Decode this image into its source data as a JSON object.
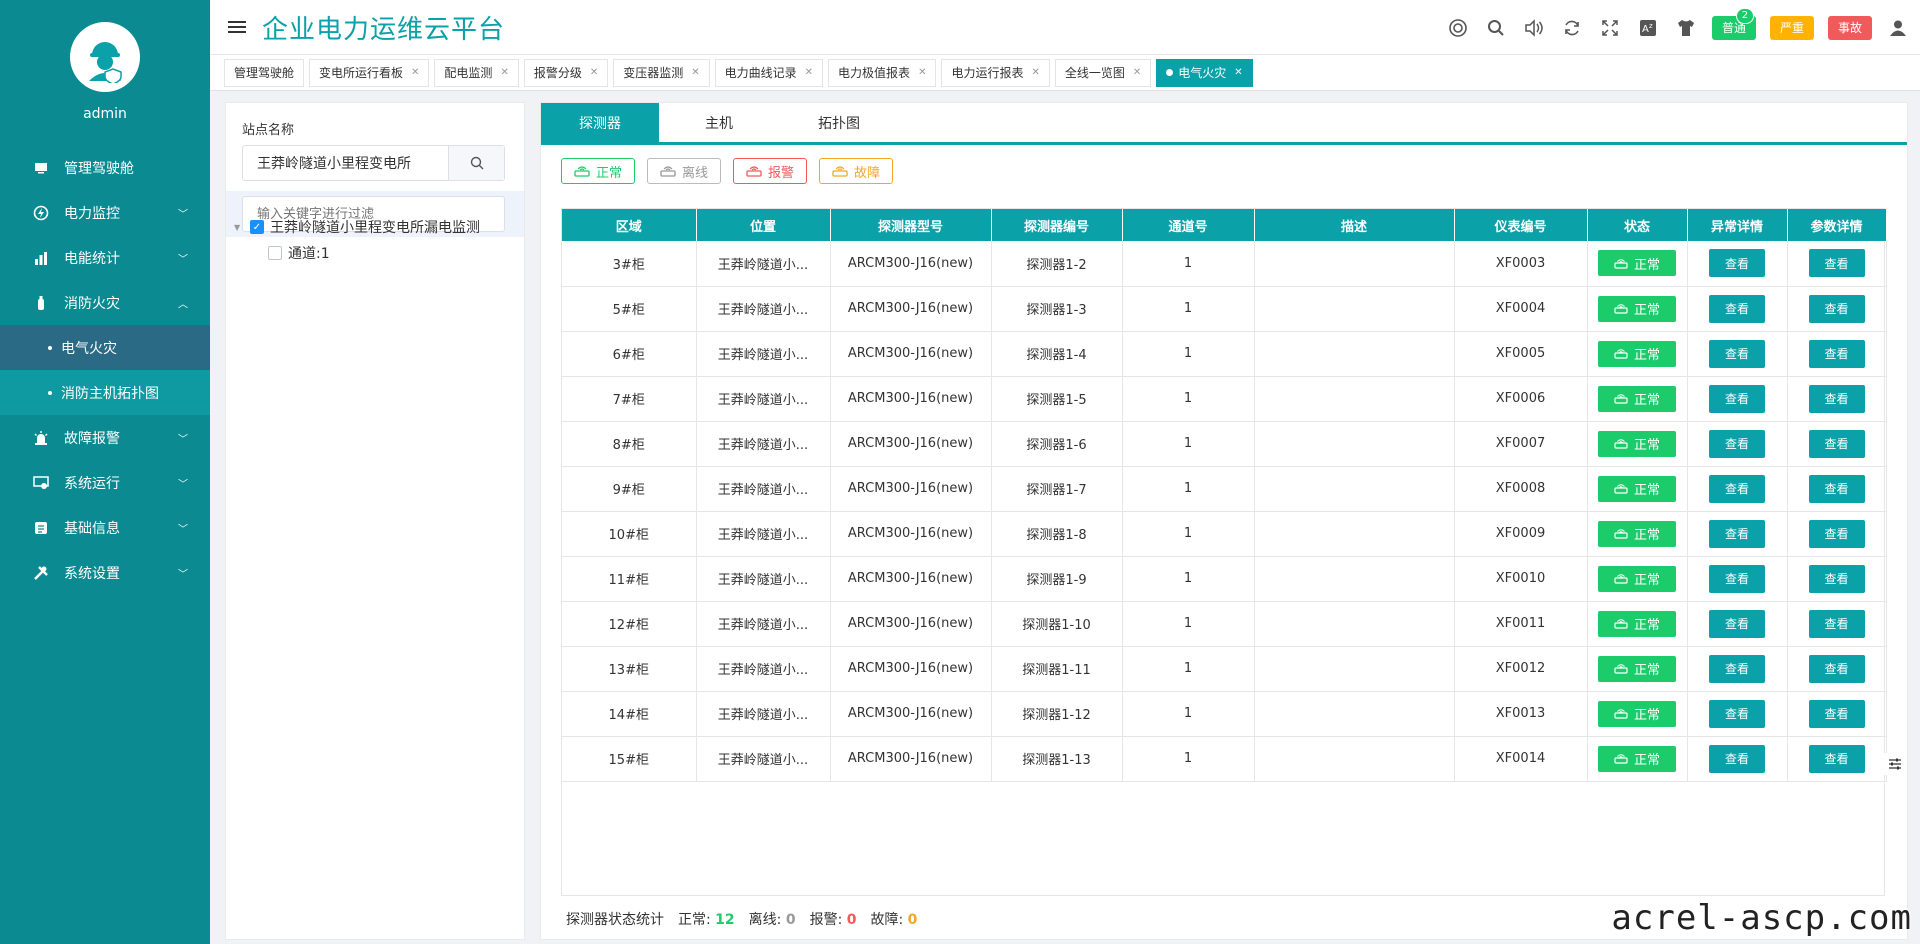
{
  "app": {
    "title": "企业电力运维云平台",
    "username": "admin"
  },
  "sidebar": {
    "items": [
      {
        "label": "管理驾驶舱",
        "icon": "monitor-icon",
        "has_children": false
      },
      {
        "label": "电力监控",
        "icon": "power-icon",
        "has_children": true
      },
      {
        "label": "电能统计",
        "icon": "bar-chart-icon",
        "has_children": true
      },
      {
        "label": "消防火灾",
        "icon": "extinguisher-icon",
        "has_children": true,
        "expanded": true
      },
      {
        "label": "故障报警",
        "icon": "alarm-icon",
        "has_children": true
      },
      {
        "label": "系统运行",
        "icon": "system-icon",
        "has_children": true
      },
      {
        "label": "基础信息",
        "icon": "info-icon",
        "has_children": true
      },
      {
        "label": "系统设置",
        "icon": "tools-icon",
        "has_children": true
      }
    ],
    "subitems": [
      {
        "label": "电气火灾",
        "active": true
      },
      {
        "label": "消防主机拓扑图",
        "active": false
      }
    ]
  },
  "header": {
    "pills": {
      "normal": "普通",
      "normal_count": "2",
      "serious": "严重",
      "accident": "事故"
    }
  },
  "tabs": [
    {
      "label": "管理驾驶舱",
      "closable": false
    },
    {
      "label": "变电所运行看板",
      "closable": true
    },
    {
      "label": "配电监测",
      "closable": true
    },
    {
      "label": "报警分级",
      "closable": true
    },
    {
      "label": "变压器监测",
      "closable": true
    },
    {
      "label": "电力曲线记录",
      "closable": true
    },
    {
      "label": "电力极值报表",
      "closable": true
    },
    {
      "label": "电力运行报表",
      "closable": true
    },
    {
      "label": "全线一览图",
      "closable": true
    },
    {
      "label": "电气火灾",
      "closable": true,
      "active": true
    }
  ],
  "left_panel": {
    "station_label": "站点名称",
    "station_value": "王莽岭隧道小里程变电所",
    "filter_placeholder": "输入关键字进行过滤",
    "tree_root": "王莽岭隧道小里程变电所漏电监测",
    "tree_child": "通道:1"
  },
  "main": {
    "tabs": [
      "探测器",
      "主机",
      "拓扑图"
    ],
    "legend": {
      "normal": "正常",
      "offline": "离线",
      "alarm": "报警",
      "fault": "故障"
    },
    "columns": [
      "区域",
      "位置",
      "探测器型号",
      "探测器编号",
      "通道号",
      "描述",
      "仪表编号",
      "状态",
      "异常详情",
      "参数详情"
    ],
    "rows": [
      {
        "area": "3#柜",
        "location": "王莽岭隧道小...",
        "model": "ARCM300-J16(new)",
        "number": "探测器1-2",
        "channel": "1",
        "desc": "",
        "meter": "XF0003",
        "status": "正常",
        "detail": "查看",
        "param": "查看"
      },
      {
        "area": "5#柜",
        "location": "王莽岭隧道小...",
        "model": "ARCM300-J16(new)",
        "number": "探测器1-3",
        "channel": "1",
        "desc": "",
        "meter": "XF0004",
        "status": "正常",
        "detail": "查看",
        "param": "查看"
      },
      {
        "area": "6#柜",
        "location": "王莽岭隧道小...",
        "model": "ARCM300-J16(new)",
        "number": "探测器1-4",
        "channel": "1",
        "desc": "",
        "meter": "XF0005",
        "status": "正常",
        "detail": "查看",
        "param": "查看"
      },
      {
        "area": "7#柜",
        "location": "王莽岭隧道小...",
        "model": "ARCM300-J16(new)",
        "number": "探测器1-5",
        "channel": "1",
        "desc": "",
        "meter": "XF0006",
        "status": "正常",
        "detail": "查看",
        "param": "查看"
      },
      {
        "area": "8#柜",
        "location": "王莽岭隧道小...",
        "model": "ARCM300-J16(new)",
        "number": "探测器1-6",
        "channel": "1",
        "desc": "",
        "meter": "XF0007",
        "status": "正常",
        "detail": "查看",
        "param": "查看"
      },
      {
        "area": "9#柜",
        "location": "王莽岭隧道小...",
        "model": "ARCM300-J16(new)",
        "number": "探测器1-7",
        "channel": "1",
        "desc": "",
        "meter": "XF0008",
        "status": "正常",
        "detail": "查看",
        "param": "查看"
      },
      {
        "area": "10#柜",
        "location": "王莽岭隧道小...",
        "model": "ARCM300-J16(new)",
        "number": "探测器1-8",
        "channel": "1",
        "desc": "",
        "meter": "XF0009",
        "status": "正常",
        "detail": "查看",
        "param": "查看"
      },
      {
        "area": "11#柜",
        "location": "王莽岭隧道小...",
        "model": "ARCM300-J16(new)",
        "number": "探测器1-9",
        "channel": "1",
        "desc": "",
        "meter": "XF0010",
        "status": "正常",
        "detail": "查看",
        "param": "查看"
      },
      {
        "area": "12#柜",
        "location": "王莽岭隧道小...",
        "model": "ARCM300-J16(new)",
        "number": "探测器1-10",
        "channel": "1",
        "desc": "",
        "meter": "XF0011",
        "status": "正常",
        "detail": "查看",
        "param": "查看"
      },
      {
        "area": "13#柜",
        "location": "王莽岭隧道小...",
        "model": "ARCM300-J16(new)",
        "number": "探测器1-11",
        "channel": "1",
        "desc": "",
        "meter": "XF0012",
        "status": "正常",
        "detail": "查看",
        "param": "查看"
      },
      {
        "area": "14#柜",
        "location": "王莽岭隧道小...",
        "model": "ARCM300-J16(new)",
        "number": "探测器1-12",
        "channel": "1",
        "desc": "",
        "meter": "XF0013",
        "status": "正常",
        "detail": "查看",
        "param": "查看"
      },
      {
        "area": "15#柜",
        "location": "王莽岭隧道小...",
        "model": "ARCM300-J16(new)",
        "number": "探测器1-13",
        "channel": "1",
        "desc": "",
        "meter": "XF0014",
        "status": "正常",
        "detail": "查看",
        "param": "查看"
      }
    ],
    "stats": {
      "label": "探测器状态统计",
      "normal_label": "正常:",
      "normal": "12",
      "offline_label": "离线:",
      "offline": "0",
      "alarm_label": "报警:",
      "alarm": "0",
      "fault_label": "故障:",
      "fault": "0"
    }
  },
  "watermark": "acrel-ascp.com",
  "colors": {
    "brand": "#0aa1a8",
    "sidebar": "#0b8a91",
    "normal": "#1ccc6a",
    "alarm": "#f05a5a",
    "fault": "#f5a623"
  }
}
